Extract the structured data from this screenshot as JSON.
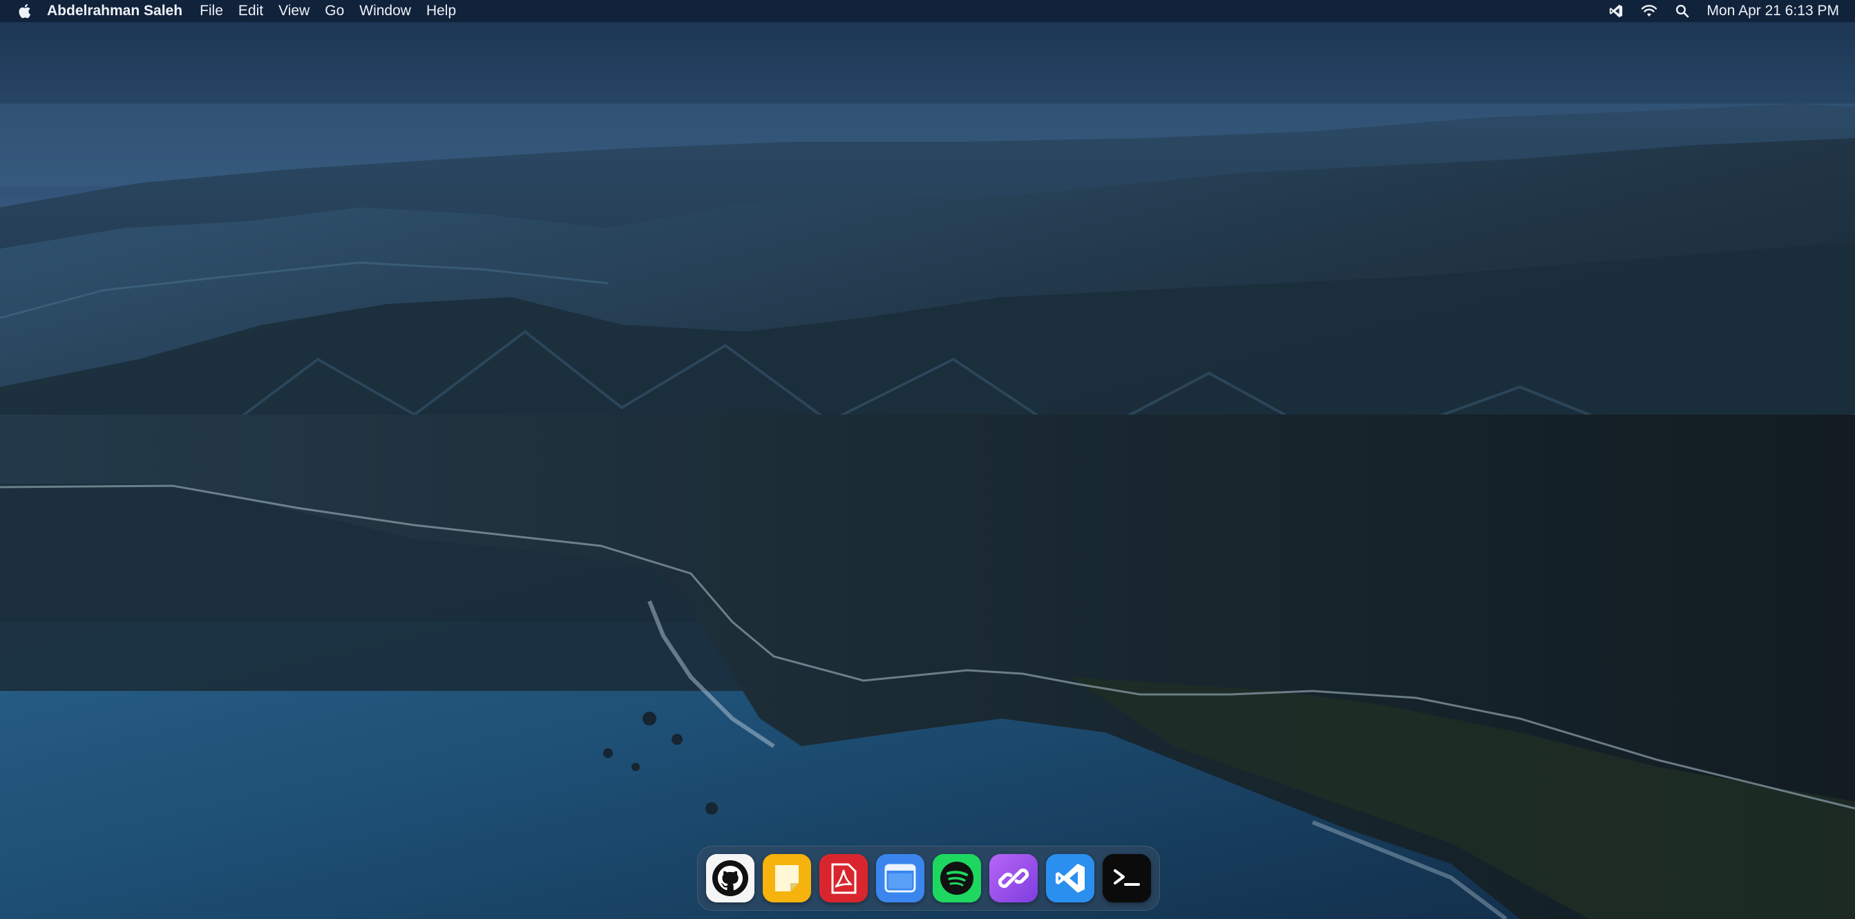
{
  "menubar": {
    "apple_icon": "apple-logo-icon",
    "app_name": "Abdelrahman Saleh",
    "menus": [
      "File",
      "Edit",
      "View",
      "Go",
      "Window",
      "Help"
    ],
    "status_icons": [
      "vscode-icon",
      "wifi-icon",
      "search-icon"
    ],
    "clock": "Mon Apr 21 6:13 PM"
  },
  "dock": {
    "apps": [
      {
        "icon": "github-icon",
        "color": "#101010"
      },
      {
        "icon": "stickies-icon",
        "color": "#f4b400"
      },
      {
        "icon": "pdf-reader-icon",
        "color": "#d9262e"
      },
      {
        "icon": "calendar-window-icon",
        "color": "#2f7de8"
      },
      {
        "icon": "spotify-icon",
        "color": "#1ed760"
      },
      {
        "icon": "link-icon",
        "color": "#9a4dea"
      },
      {
        "icon": "vscode-icon",
        "color": "#2b8ff0"
      },
      {
        "icon": "terminal-icon",
        "color": "#0a0a0a"
      }
    ]
  },
  "wallpaper": {
    "sea_color": "#1d4d72",
    "mountain_color": "#1c2d3a"
  }
}
